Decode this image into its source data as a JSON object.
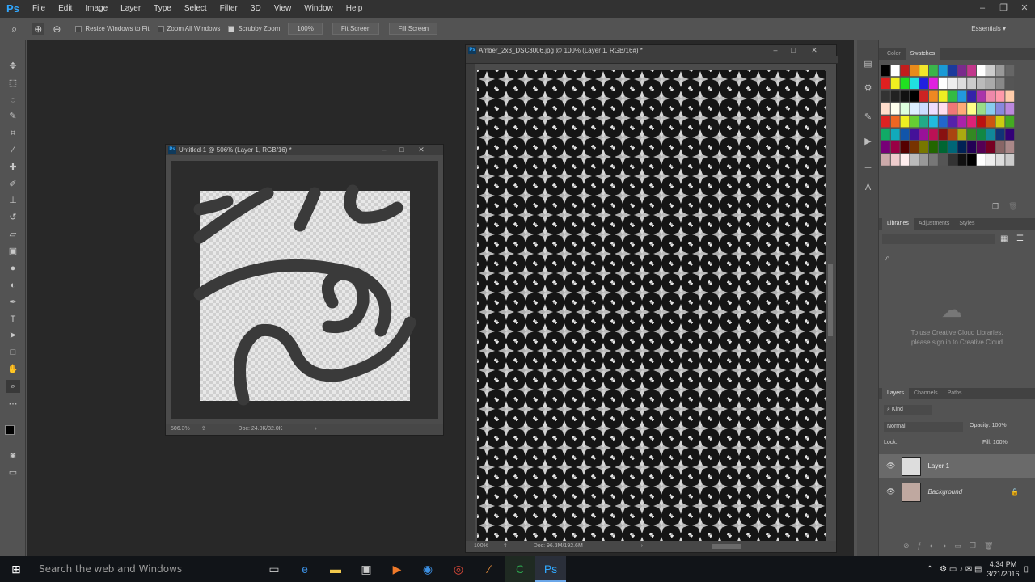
{
  "app": {
    "logo": "Ps"
  },
  "menu": [
    "File",
    "Edit",
    "Image",
    "Layer",
    "Type",
    "Select",
    "Filter",
    "3D",
    "View",
    "Window",
    "Help"
  ],
  "options": {
    "resize_windows": "Resize Windows to Fit",
    "zoom_all": "Zoom All Windows",
    "scrubby": "Scrubby Zoom",
    "zoom_value": "100%",
    "fit_screen": "Fit Screen",
    "fill_screen": "Fill Screen",
    "workspace": "Essentials"
  },
  "doc1": {
    "title": "Untitled-1 @ 506% (Layer 1, RGB/16) *",
    "zoom": "506.3%",
    "info": "Doc: 24.0K/32.0K"
  },
  "doc2": {
    "title": "Amber_2x3_DSC3006.jpg @ 100% (Layer 1, RGB/16#) *",
    "zoom": "100%",
    "info": "Doc: 96.3M/192.6M"
  },
  "panels": {
    "color_tabs": [
      "Color",
      "Swatches"
    ],
    "lib_tabs": [
      "Libraries",
      "Adjustments",
      "Styles"
    ],
    "lib_msg1": "To use Creative Cloud Libraries,",
    "lib_msg2": "please sign in to Creative Cloud",
    "layer_tabs": [
      "Layers",
      "Channels",
      "Paths"
    ],
    "kind": "Kind",
    "blend": "Normal",
    "opacity_label": "Opacity:",
    "opacity": "100%",
    "lock_label": "Lock:",
    "fill_label": "Fill:",
    "fill": "100%",
    "layers": [
      "Layer 1",
      "Background"
    ]
  },
  "taskbar": {
    "search": "Search the web and Windows",
    "time": "4:34 PM",
    "date": "3/21/2016"
  },
  "colors": {
    "accent": "#31a8ff"
  }
}
